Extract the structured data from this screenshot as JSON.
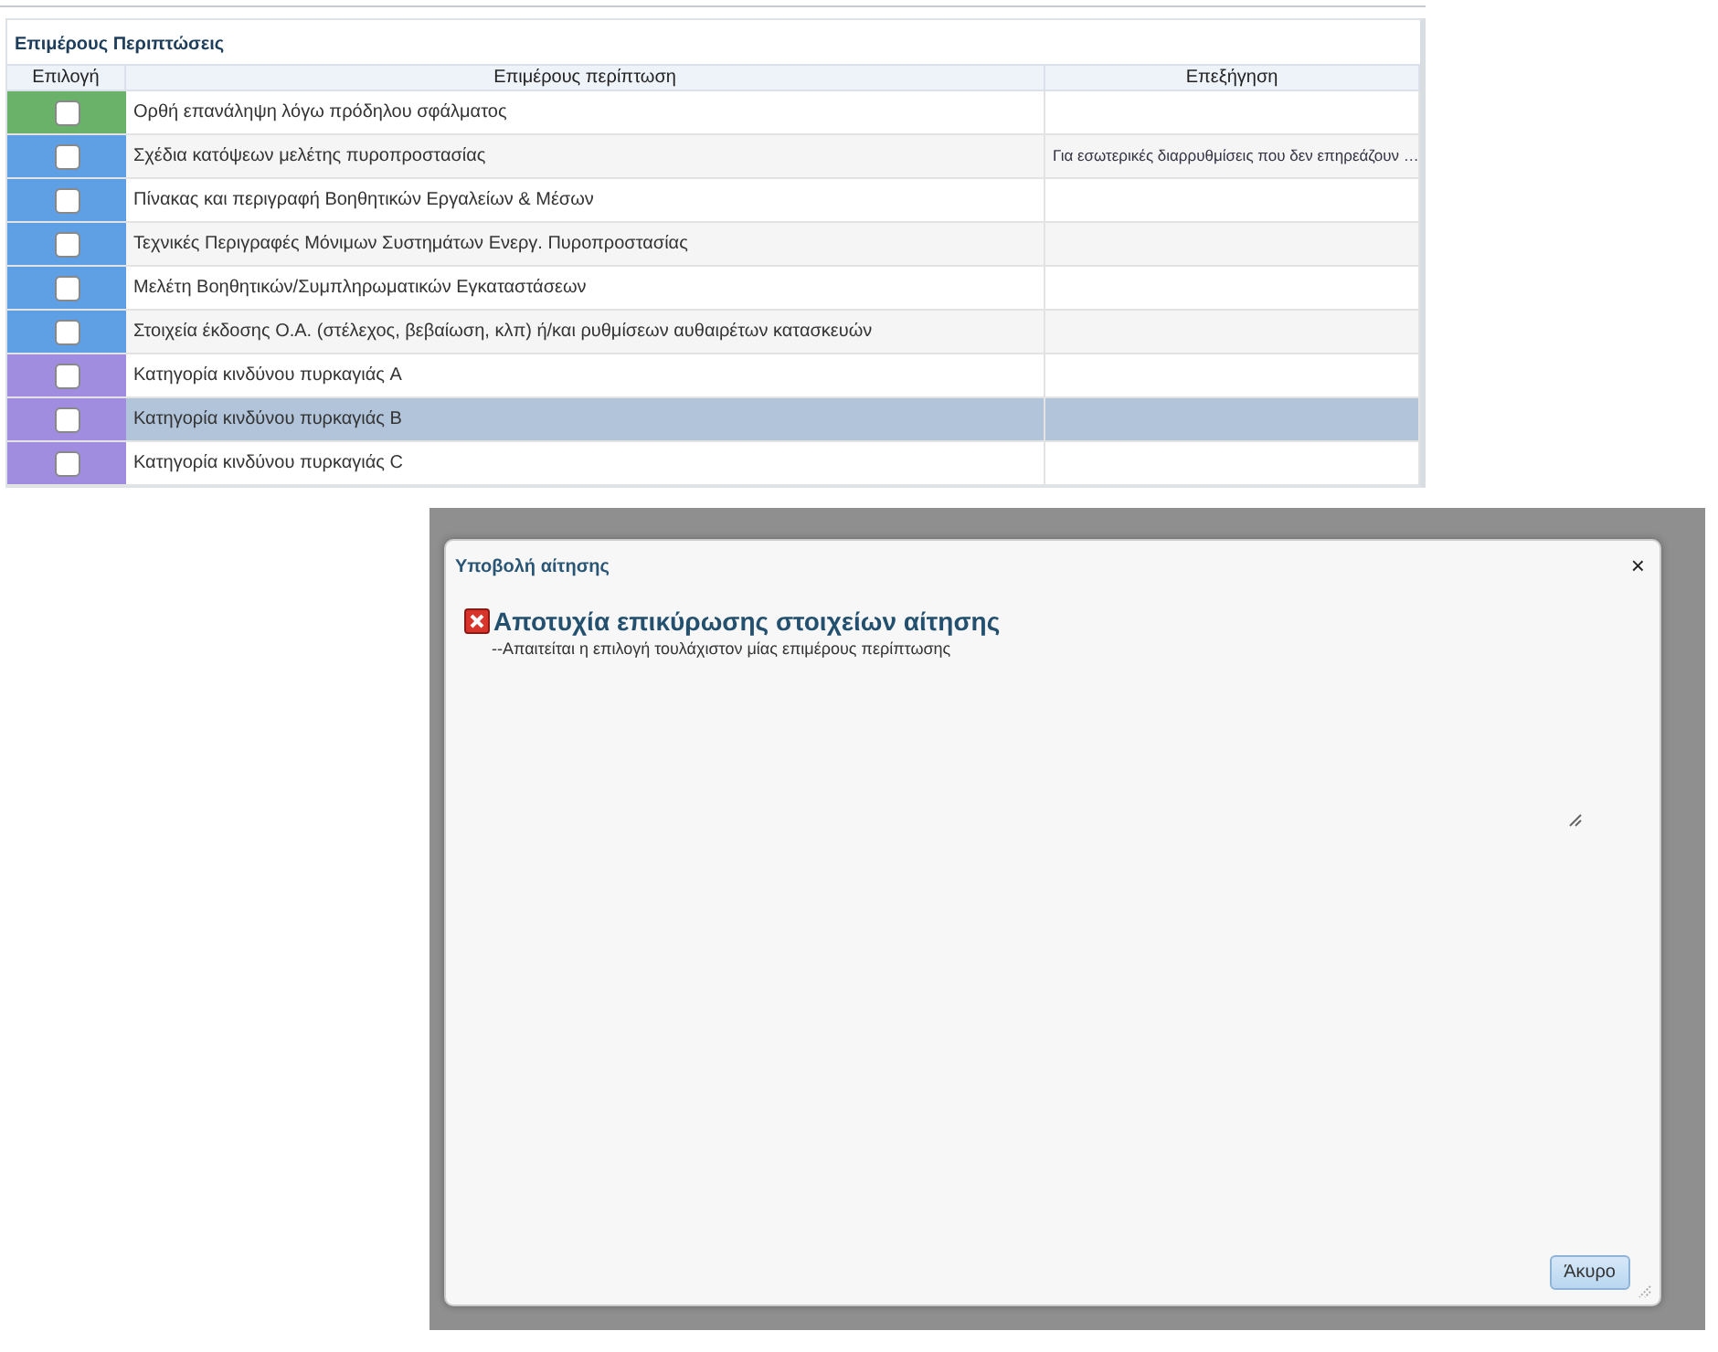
{
  "panel": {
    "title": "Επιμέρους Περιπτώσεις"
  },
  "table": {
    "columns": [
      "Επιλογή",
      "Επιμέρους περίπτωση",
      "Επεξήγηση"
    ],
    "rows": [
      {
        "color": "#6ab26a",
        "checked": false,
        "selected": false,
        "case": "Ορθή επανάληψη λόγω πρόδηλου σφάλματος",
        "explanation": ""
      },
      {
        "color": "#5f9fe3",
        "checked": false,
        "selected": false,
        "case": "Σχέδια κατόψεων μελέτης πυροπροστασίας",
        "explanation": "Για εσωτερικές διαρρυθμίσεις που δεν επηρεάζουν …"
      },
      {
        "color": "#5f9fe3",
        "checked": false,
        "selected": false,
        "case": "Πίνακας και περιγραφή Βοηθητικών Εργαλείων & Μέσων",
        "explanation": ""
      },
      {
        "color": "#5f9fe3",
        "checked": false,
        "selected": false,
        "case": "Τεχνικές Περιγραφές Μόνιμων Συστημάτων Ενεργ. Πυροπροστασίας",
        "explanation": ""
      },
      {
        "color": "#5f9fe3",
        "checked": false,
        "selected": false,
        "case": "Μελέτη Βοηθητικών/Συμπληρωματικών Εγκαταστάσεων",
        "explanation": ""
      },
      {
        "color": "#5f9fe3",
        "checked": false,
        "selected": false,
        "case": "Στοιχεία έκδοσης Ο.Α. (στέλεχος, βεβαίωση, κλπ) ή/και ρυθμίσεων αυθαιρέτων κατασκευών",
        "explanation": ""
      },
      {
        "color": "#a18de0",
        "checked": false,
        "selected": false,
        "case": "Κατηγορία κινδύνου πυρκαγιάς A",
        "explanation": ""
      },
      {
        "color": "#a18de0",
        "checked": false,
        "selected": true,
        "case": "Κατηγορία κινδύνου πυρκαγιάς B",
        "explanation": ""
      },
      {
        "color": "#a18de0",
        "checked": false,
        "selected": false,
        "case": "Κατηγορία κινδύνου πυρκαγιάς C",
        "explanation": ""
      }
    ]
  },
  "dialog": {
    "title": "Υποβολή αίτησης",
    "close": "×",
    "error_heading": "Αποτυχία επικύρωσης στοιχείων αίτησης",
    "error_message": "--Απαιτείται η επιλογή τουλάχιστον μίας επιμέρους περίπτωσης",
    "buttons": [
      "Άκυρο"
    ]
  }
}
